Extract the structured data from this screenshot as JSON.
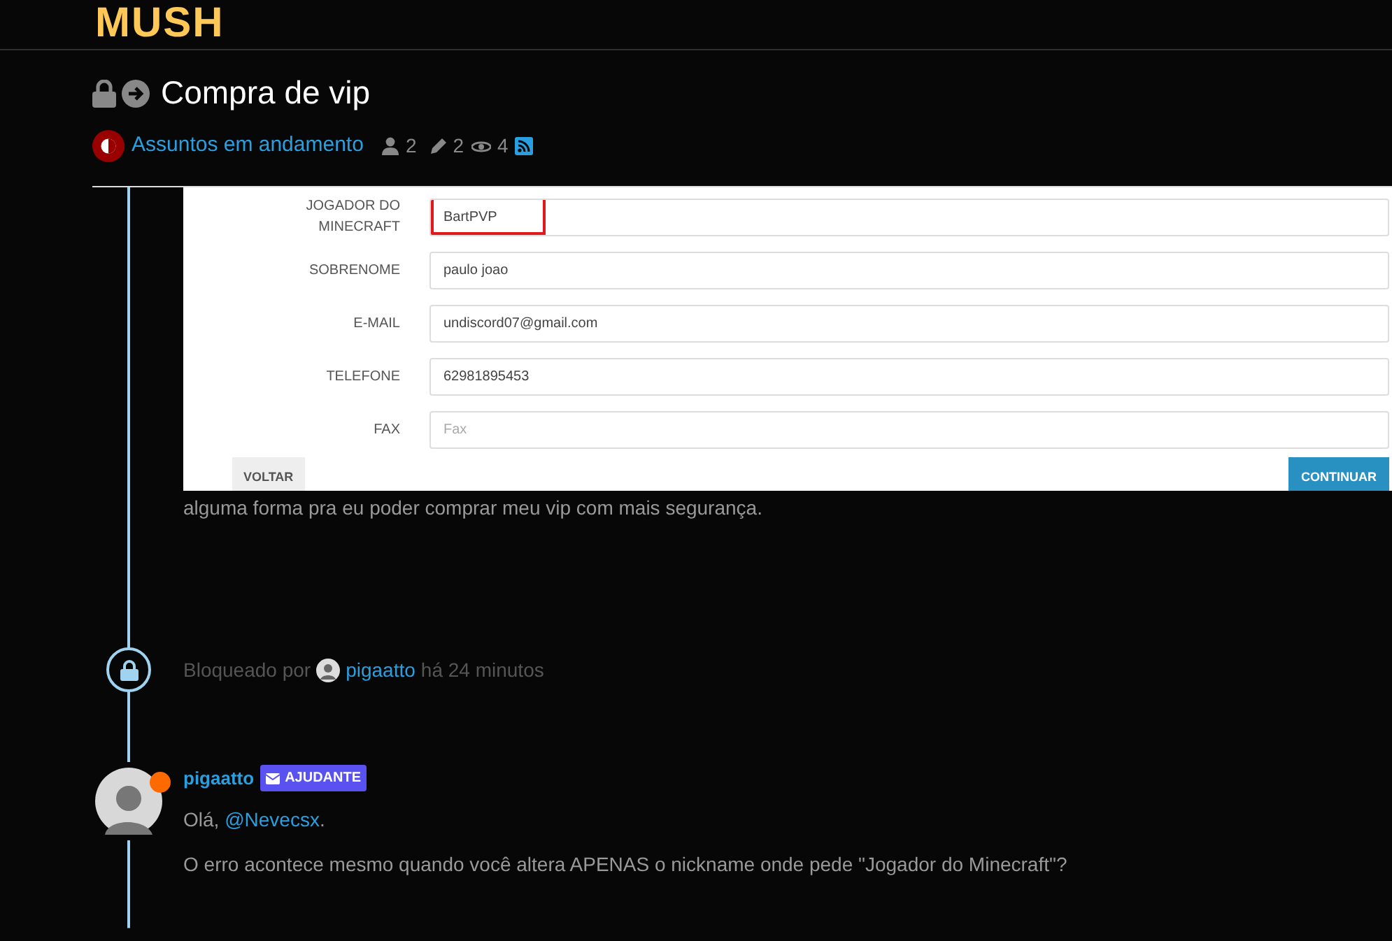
{
  "logo": "MUSH",
  "topic": {
    "title": "Compra de vip",
    "locked": true,
    "category": "Assuntos em andamento",
    "participants": "2",
    "posts": "2",
    "views": "4"
  },
  "screenshot": {
    "fields": [
      {
        "label": "JOGADOR DO MINECRAFT",
        "value": "BartPVP",
        "highlighted": true
      },
      {
        "label": "SOBRENOME",
        "value": "paulo joao",
        "highlighted": false
      },
      {
        "label": "E-MAIL",
        "value": "undiscord07@gmail.com",
        "highlighted": false
      },
      {
        "label": "TELEFONE",
        "value": "62981895453",
        "highlighted": false
      },
      {
        "label": "FAX",
        "placeholder": "Fax",
        "highlighted": false
      }
    ],
    "back_button": "VOLTAR",
    "continue_button": "CONTINUAR"
  },
  "post_text": "alguma forma pra eu poder comprar meu vip com mais segurança.",
  "lock_event": {
    "prefix": "Bloqueado por",
    "user": "pigaatto",
    "time": "há 24 minutos"
  },
  "reply": {
    "author": "pigaatto",
    "online": true,
    "badge": "AJUDANTE",
    "greeting": "Olá,",
    "mention": "@Nevecsx",
    "greeting_end": ".",
    "body": "O erro acontece mesmo quando você altera APENAS o nickname onde pede \"Jogador do Minecraft\"?"
  }
}
